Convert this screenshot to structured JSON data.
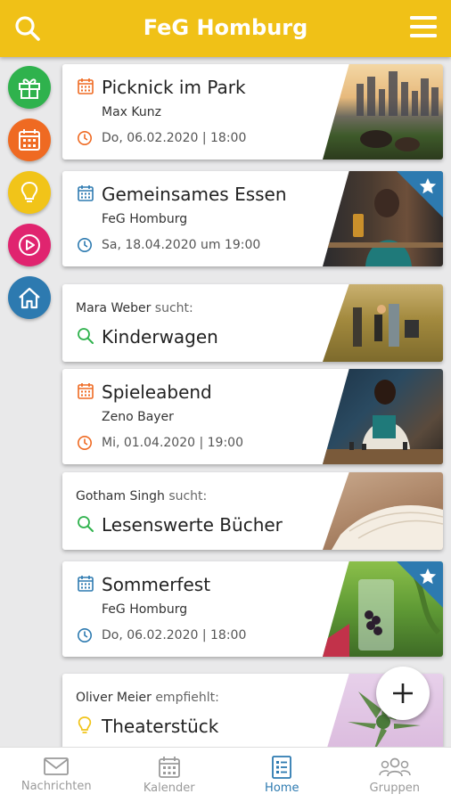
{
  "header": {
    "title": "FeG Homburg",
    "search_icon": "search-icon",
    "menu_icon": "hamburger-menu-icon"
  },
  "side_menu": [
    {
      "icon": "gift-icon",
      "color": "#2fb24d"
    },
    {
      "icon": "calendar-icon",
      "color": "#ef6a22"
    },
    {
      "icon": "lightbulb-icon",
      "color": "#f1c419"
    },
    {
      "icon": "play-icon",
      "color": "#e0246f"
    },
    {
      "icon": "home-icon",
      "color": "#2d7ab0"
    }
  ],
  "cards": [
    {
      "type": "event",
      "title": "Picknick im Park",
      "organizer": "Max Kunz",
      "datetime": "Do, 06.02.2020 | 18:00",
      "accent": "#ef6a22",
      "starred": false
    },
    {
      "type": "event",
      "title": "Gemeinsames Essen",
      "organizer": "FeG Homburg",
      "datetime": "Sa, 18.04.2020 um 19:00",
      "accent": "#2d7ab0",
      "starred": true
    },
    {
      "type": "search",
      "person": "Mara Weber",
      "verb": "sucht:",
      "title": "Kinderwagen",
      "accent": "#2fb24d"
    },
    {
      "type": "event",
      "title": "Spieleabend",
      "organizer": "Zeno Bayer",
      "datetime": "Mi, 01.04.2020 | 19:00",
      "accent": "#ef6a22",
      "starred": false
    },
    {
      "type": "search",
      "person": "Gotham Singh",
      "verb": "sucht:",
      "title": "Lesenswerte Bücher",
      "accent": "#2fb24d"
    },
    {
      "type": "event",
      "title": "Sommerfest",
      "organizer": "FeG Homburg",
      "datetime": "Do, 06.02.2020 | 18:00",
      "accent": "#2d7ab0",
      "starred": true
    },
    {
      "type": "recommend",
      "person": "Oliver Meier",
      "verb": "empfiehlt:",
      "title": "Theaterstück",
      "accent": "#f1c419"
    }
  ],
  "fab": {
    "icon": "plus-icon"
  },
  "bottom_nav": [
    {
      "label": "Nachrichten",
      "icon": "envelope-icon",
      "active": false
    },
    {
      "label": "Kalender",
      "icon": "calendar-icon",
      "active": false
    },
    {
      "label": "Home",
      "icon": "list-icon",
      "active": true
    },
    {
      "label": "Gruppen",
      "icon": "group-icon",
      "active": false
    }
  ],
  "colors": {
    "header": "#f0c117",
    "active_nav": "#2d7ab0",
    "background": "#e9e9ea"
  }
}
